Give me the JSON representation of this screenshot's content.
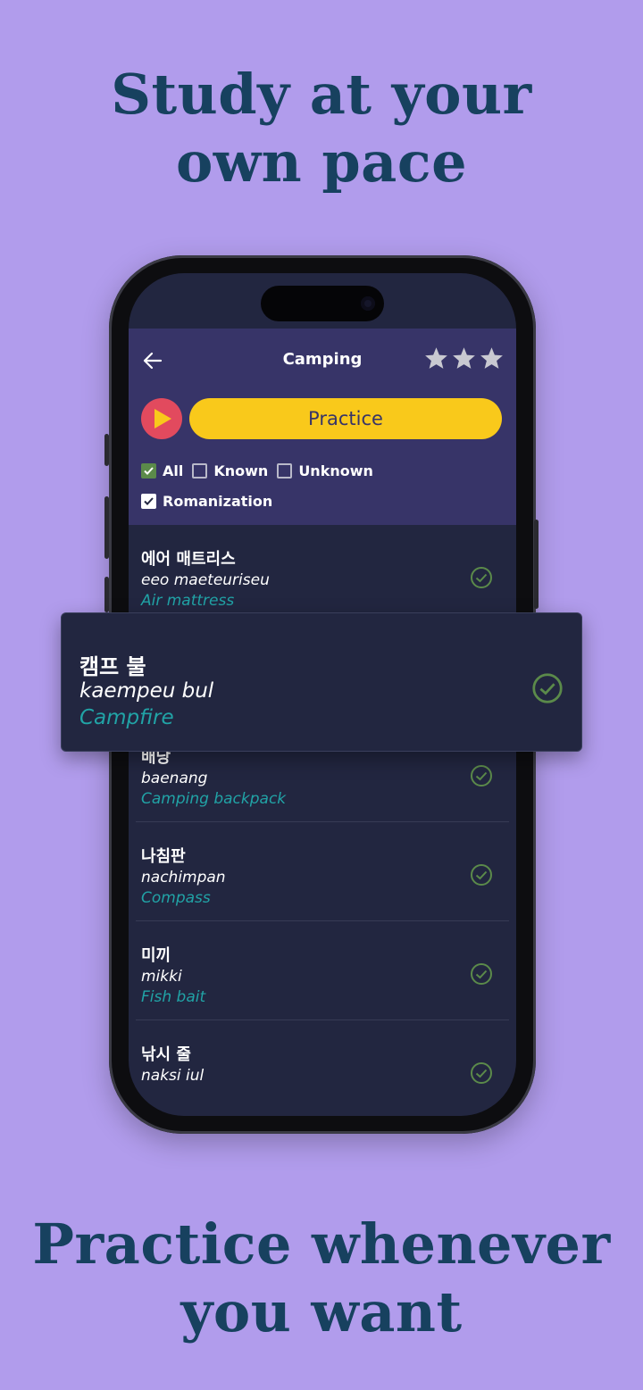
{
  "headline_top": [
    "Study at your",
    "own pace"
  ],
  "headline_bottom": [
    "Practice whenever",
    "you want"
  ],
  "app": {
    "title": "Camping",
    "stars": 3,
    "practice_label": "Practice",
    "filters": {
      "all": {
        "label": "All",
        "checked": true
      },
      "known": {
        "label": "Known",
        "checked": false
      },
      "unknown": {
        "label": "Unknown",
        "checked": false
      },
      "romanization": {
        "label": "Romanization",
        "checked": true
      }
    },
    "words": [
      {
        "korean": "에어 매트리스",
        "roman": "eeo maeteuriseu",
        "english": "Air mattress",
        "known": true
      },
      {
        "korean": "캠프 불",
        "roman": "kaempeu bul",
        "english": "Campfire",
        "known": true
      },
      {
        "korean": "배낭",
        "roman": "baenang",
        "english": "Camping backpack",
        "known": true
      },
      {
        "korean": "나침판",
        "roman": "nachimpan",
        "english": "Compass",
        "known": true
      },
      {
        "korean": "미끼",
        "roman": "mikki",
        "english": "Fish bait",
        "known": true
      },
      {
        "korean": "낚시 줄",
        "roman": "naksi iul",
        "english": "",
        "known": true
      }
    ]
  },
  "colors": {
    "background": "#b19cec",
    "headline": "#17415f",
    "header": "#373468",
    "list_bg": "#222640",
    "practice_button": "#f9c91b",
    "play_button": "#e24a5e",
    "english_text": "#21a3a6",
    "check_icon": "#5b8a4a"
  }
}
